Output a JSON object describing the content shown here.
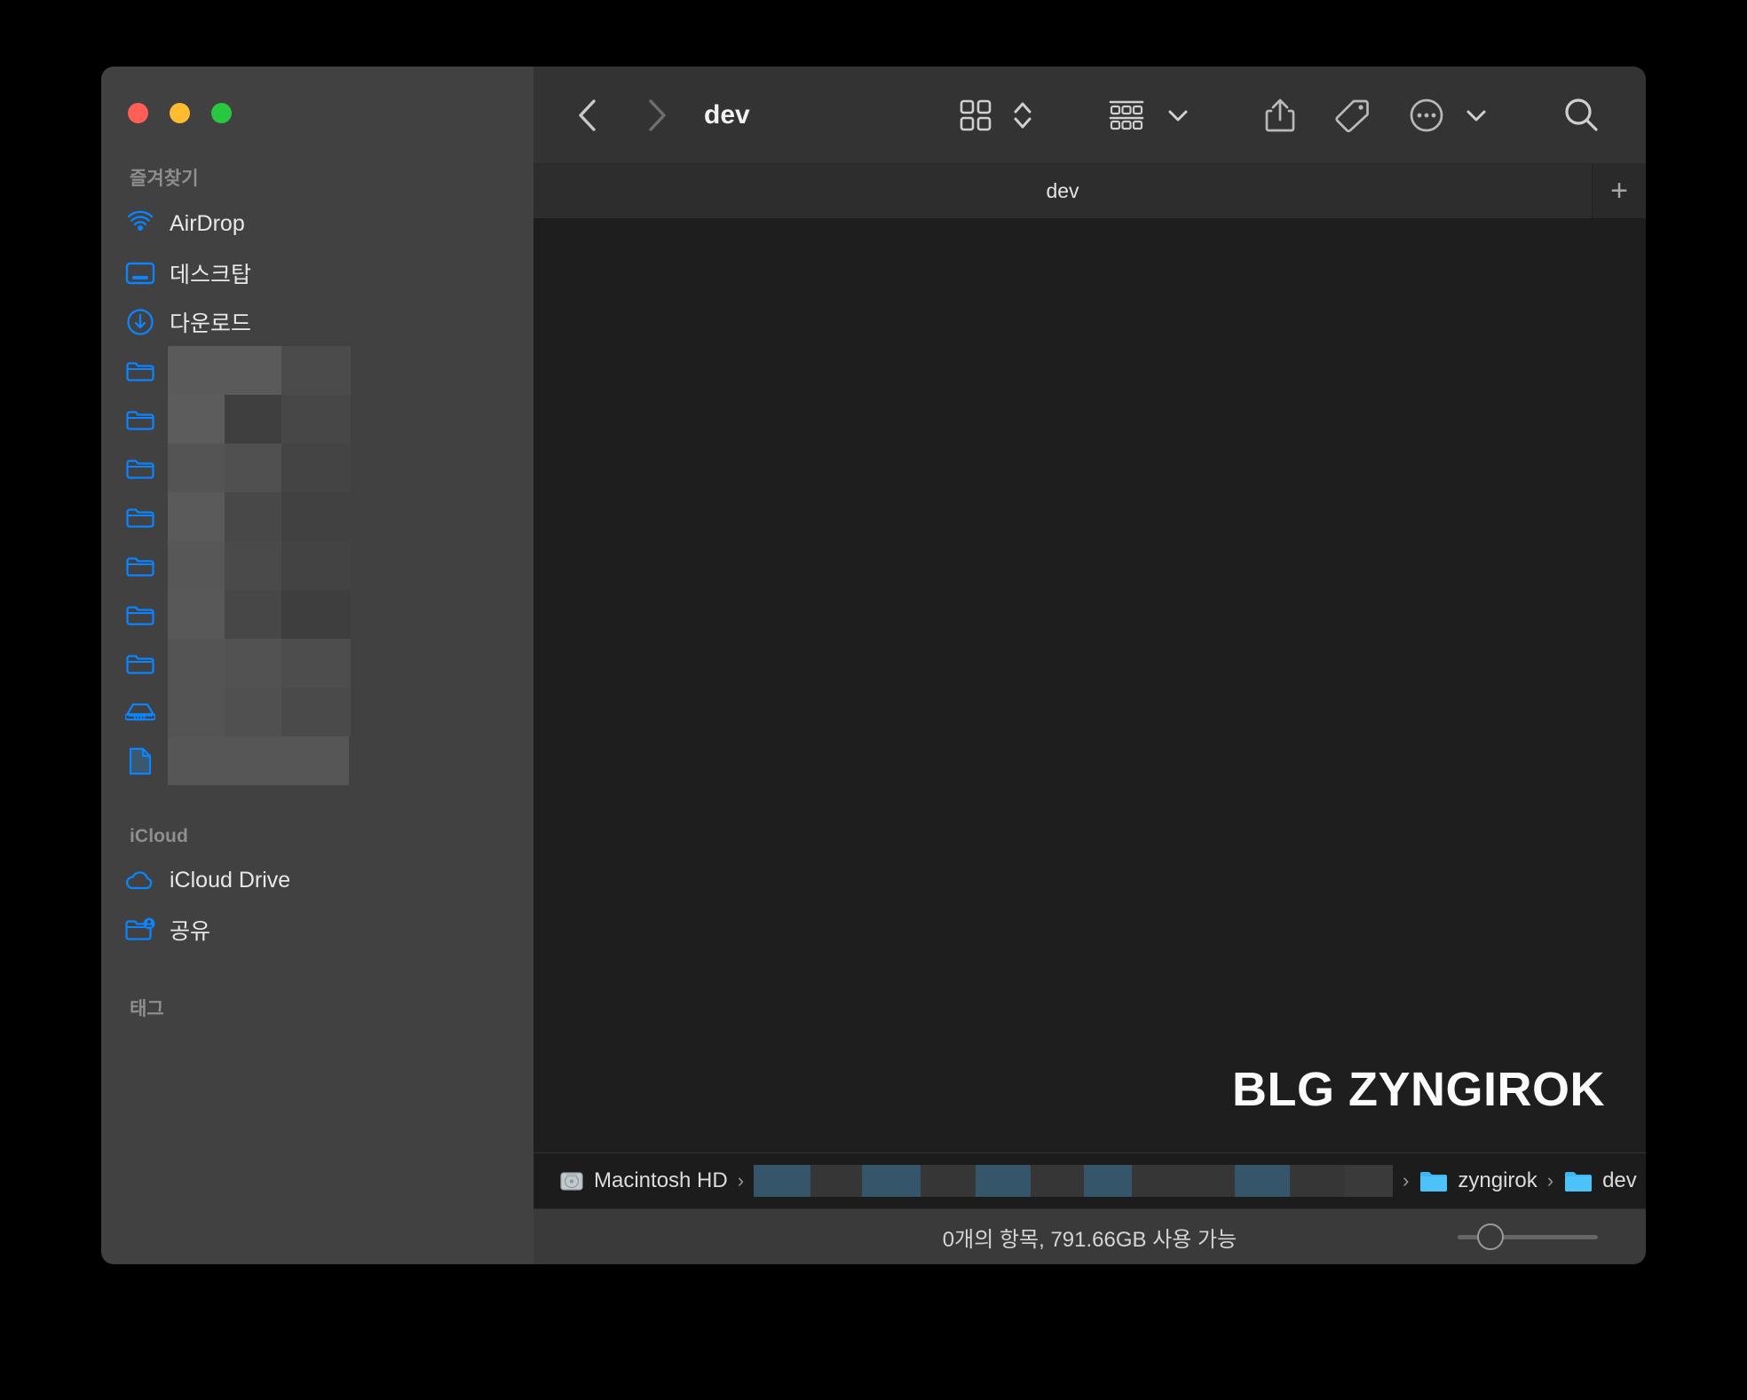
{
  "window": {
    "title": "dev",
    "traffic_lights": [
      {
        "name": "close",
        "color": "#ff5f57"
      },
      {
        "name": "minimize",
        "color": "#febc2e"
      },
      {
        "name": "zoom",
        "color": "#28c840"
      }
    ]
  },
  "sidebar": {
    "sections": [
      {
        "title": "즐겨찾기",
        "items": [
          {
            "label": "AirDrop",
            "icon": "airdrop-icon",
            "redacted": false
          },
          {
            "label": "데스크탑",
            "icon": "desktop-icon",
            "redacted": false
          },
          {
            "label": "다운로드",
            "icon": "downloads-icon",
            "redacted": false
          },
          {
            "label": "",
            "icon": "folder-icon",
            "redacted": true,
            "blocks": [
              [
                0,
                128,
                "#5a5a5a"
              ],
              [
                128,
                78,
                "#4b4b4b"
              ]
            ]
          },
          {
            "label": "",
            "icon": "folder-icon",
            "redacted": true,
            "blocks": [
              [
                0,
                64,
                "#5c5c5c"
              ],
              [
                64,
                64,
                "#3f3f3f"
              ],
              [
                128,
                78,
                "#474747"
              ]
            ]
          },
          {
            "label": "",
            "icon": "folder-icon",
            "redacted": true,
            "blocks": [
              [
                0,
                64,
                "#545454"
              ],
              [
                64,
                64,
                "#505050"
              ],
              [
                128,
                78,
                "#444444"
              ]
            ]
          },
          {
            "label": "",
            "icon": "folder-icon",
            "redacted": true,
            "blocks": [
              [
                0,
                64,
                "#5a5a5a"
              ],
              [
                64,
                64,
                "#484848"
              ],
              [
                128,
                78,
                "#414141"
              ]
            ]
          },
          {
            "label": "",
            "icon": "folder-icon",
            "redacted": true,
            "blocks": [
              [
                0,
                64,
                "#575757"
              ],
              [
                64,
                64,
                "#4a4a4a"
              ],
              [
                128,
                78,
                "#434343"
              ]
            ]
          },
          {
            "label": "",
            "icon": "folder-icon",
            "redacted": true,
            "blocks": [
              [
                0,
                64,
                "#585858"
              ],
              [
                64,
                64,
                "#474747"
              ],
              [
                128,
                78,
                "#3e3e3e"
              ]
            ]
          },
          {
            "label": "",
            "icon": "folder-icon",
            "redacted": true,
            "blocks": [
              [
                0,
                64,
                "#545454"
              ],
              [
                64,
                64,
                "#525252"
              ],
              [
                128,
                78,
                "#4d4d4d"
              ]
            ]
          },
          {
            "label": "",
            "icon": "harddisk-icon",
            "redacted": true,
            "blocks": [
              [
                0,
                64,
                "#545454"
              ],
              [
                64,
                64,
                "#505050"
              ],
              [
                128,
                78,
                "#4a4a4a"
              ]
            ]
          },
          {
            "label": "",
            "icon": "document-icon",
            "redacted": true,
            "blocks": [
              [
                0,
                64,
                "#565656"
              ],
              [
                64,
                90,
                "#565656"
              ],
              [
                154,
                50,
                "#565656"
              ]
            ]
          }
        ]
      },
      {
        "title": "iCloud",
        "items": [
          {
            "label": "iCloud Drive",
            "icon": "cloud-icon",
            "redacted": false
          },
          {
            "label": "공유",
            "icon": "shared-folder-icon",
            "redacted": false
          }
        ]
      },
      {
        "title": "태그",
        "items": []
      }
    ]
  },
  "toolbar": {
    "back_label": "‹",
    "forward_label": "›",
    "title": "dev",
    "buttons": [
      {
        "name": "icon-view-button",
        "icon": "grid-view-icon"
      },
      {
        "name": "view-sort-stepper",
        "icon": "chevron-up-down-icon"
      },
      {
        "name": "group-by-button",
        "icon": "group-list-icon"
      },
      {
        "name": "group-by-chevron",
        "icon": "chevron-down-icon"
      },
      {
        "name": "share-button",
        "icon": "share-icon"
      },
      {
        "name": "tag-button",
        "icon": "tag-icon"
      },
      {
        "name": "more-button",
        "icon": "ellipsis-circle-icon"
      },
      {
        "name": "more-chevron",
        "icon": "chevron-down-icon"
      },
      {
        "name": "search-button",
        "icon": "search-icon"
      }
    ]
  },
  "tabs": {
    "items": [
      {
        "label": "dev",
        "active": true
      }
    ],
    "new_tab_label": "+"
  },
  "content": {
    "watermark": "BLG ZYNGIROK"
  },
  "pathbar": {
    "root": "Macintosh HD",
    "redacted_segments": [
      {
        "blocks": [
          [
            0,
            64,
            "#35556a"
          ],
          [
            64,
            58,
            "#363636"
          ],
          [
            122,
            66,
            "#35556a"
          ],
          [
            188,
            62,
            "#363636"
          ],
          [
            250,
            62,
            "#35556a"
          ],
          [
            312,
            60,
            "#363636"
          ],
          [
            372,
            54,
            "#35556a"
          ],
          [
            426,
            58,
            "#363636"
          ],
          [
            484,
            58,
            "#363636"
          ],
          [
            542,
            62,
            "#35556a"
          ],
          [
            604,
            62,
            "#363636"
          ],
          [
            666,
            54,
            "#3a3a3a"
          ]
        ]
      }
    ],
    "tail_segments": [
      "zyngirok",
      "dev"
    ],
    "separator": "›"
  },
  "statusbar": {
    "text": "0개의 항목, 791.66GB 사용 가능",
    "zoom_value": 22
  },
  "colors": {
    "accent": "#0a84ff",
    "sidebar_bg": "#414141",
    "content_bg": "#1e1e1e",
    "toolbar_bg": "#333333",
    "statusbar_bg": "#3a3a3a",
    "folder_blue": "#3fb7f5"
  }
}
